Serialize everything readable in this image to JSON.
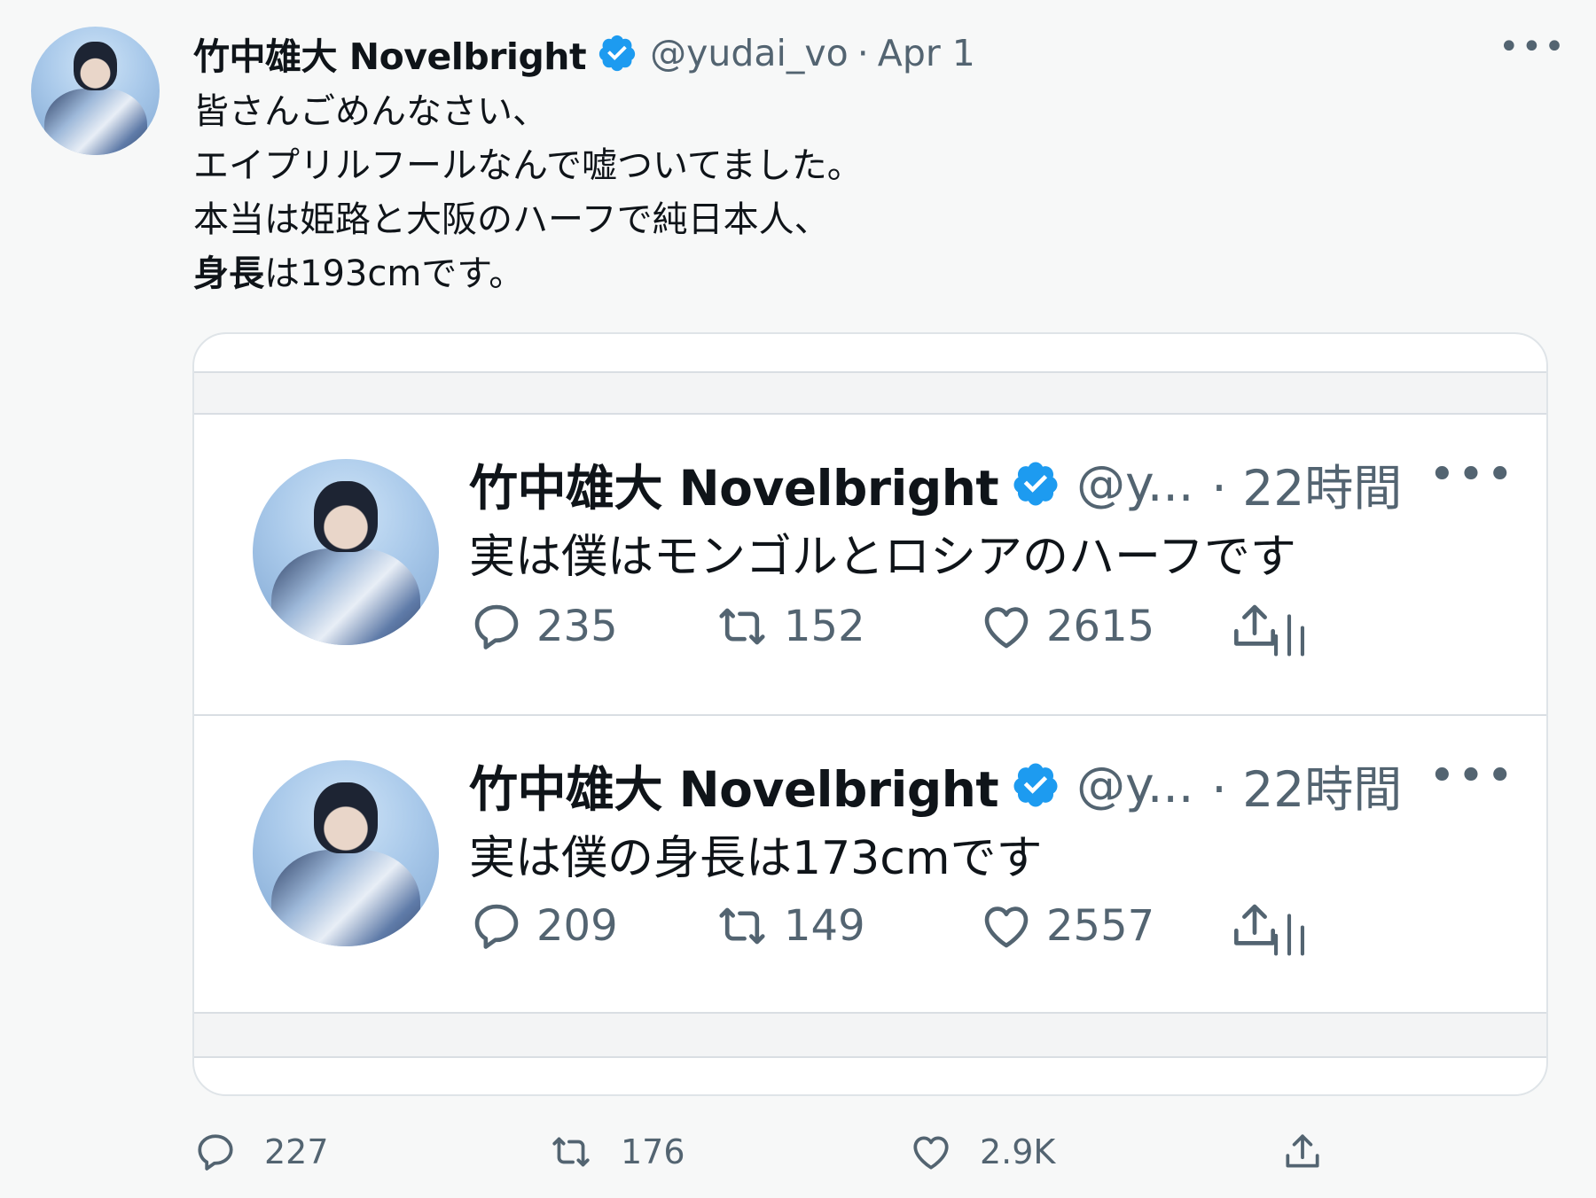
{
  "main": {
    "name": "竹中雄大 Novelbright",
    "handle": "@yudai_vo",
    "date": "Apr 1",
    "separator": "·",
    "more": "•••",
    "lines": [
      "皆さんごめんなさい、",
      "エイプリルフールなんで嘘ついてました。",
      "本当は姫路と大阪のハーフで純日本人、"
    ],
    "last_line_bold": "身長",
    "last_line_rest": "は193cmです。"
  },
  "quoted": [
    {
      "name": "竹中雄大 Novelbright",
      "handle": "@y...",
      "time": "· 22時間",
      "more": "•••",
      "text": "実は僕はモンゴルとロシアのハーフです",
      "replies": "235",
      "retweets": "152",
      "likes": "2615"
    },
    {
      "name": "竹中雄大 Novelbright",
      "handle": "@y...",
      "time": "· 22時間",
      "more": "•••",
      "text": "実は僕の身長は173cmです",
      "replies": "209",
      "retweets": "149",
      "likes": "2557"
    }
  ],
  "actions": {
    "replies": "227",
    "retweets": "176",
    "likes": "2.9K"
  },
  "colors": {
    "verified": "#1d9bf0",
    "secondary_text": "#536471"
  }
}
